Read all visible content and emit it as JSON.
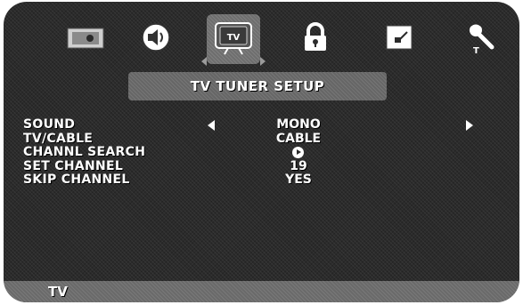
{
  "icons": [
    {
      "name": "picture-icon",
      "active": false
    },
    {
      "name": "sound-icon",
      "active": false
    },
    {
      "name": "tv-icon",
      "label": "TV",
      "active": true
    },
    {
      "name": "lock-icon",
      "active": false
    },
    {
      "name": "setup-icon",
      "active": false
    },
    {
      "name": "tools-icon",
      "label": "T",
      "active": false
    }
  ],
  "title": "TV TUNER SETUP",
  "menu": [
    {
      "label": "SOUND",
      "value": "MONO"
    },
    {
      "label": "TV/CABLE",
      "value": "CABLE"
    },
    {
      "label": "CHANNL SEARCH",
      "value": ""
    },
    {
      "label": "SET CHANNEL",
      "value": "19"
    },
    {
      "label": "SKIP CHANNEL",
      "value": "YES"
    }
  ],
  "footer": {
    "label": "TV"
  },
  "colors": {
    "background": "#2b2b2b",
    "highlight": "#6e6e6e",
    "text": "#ffffff"
  }
}
